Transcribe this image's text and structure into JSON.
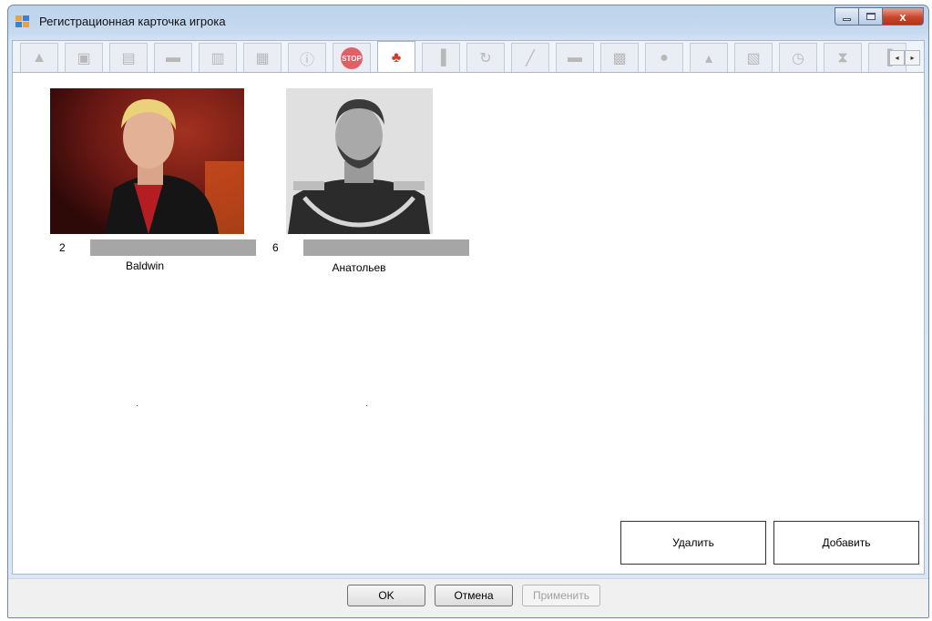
{
  "window": {
    "title": "Регистрационная карточка игрока",
    "close_glyph": "x"
  },
  "tabs": [
    {
      "icon": "user-icon",
      "glyph": "▲",
      "active": false
    },
    {
      "icon": "lock-icon",
      "glyph": "▣",
      "active": false
    },
    {
      "icon": "document-icon",
      "glyph": "▤",
      "active": false
    },
    {
      "icon": "card-icon",
      "glyph": "▬",
      "active": false
    },
    {
      "icon": "page-icon",
      "glyph": "▥",
      "active": false
    },
    {
      "icon": "id-card-icon",
      "glyph": "▦",
      "active": false
    },
    {
      "icon": "info-icon",
      "glyph": "ⓘ",
      "active": false
    },
    {
      "icon": "stop-icon",
      "glyph": "STOP",
      "active": false
    },
    {
      "icon": "people-icon",
      "glyph": "♣",
      "active": true
    },
    {
      "icon": "bar-chart-icon",
      "glyph": "▐",
      "active": false
    },
    {
      "icon": "refresh-icon",
      "glyph": "↻",
      "active": false
    },
    {
      "icon": "pen-icon",
      "glyph": "╱",
      "active": false
    },
    {
      "icon": "car-icon",
      "glyph": "▬",
      "active": false
    },
    {
      "icon": "calculator-icon",
      "glyph": "▩",
      "active": false
    },
    {
      "icon": "coins-icon",
      "glyph": "●",
      "active": false
    },
    {
      "icon": "money-bag-icon",
      "glyph": "▴",
      "active": false
    },
    {
      "icon": "notebook-icon",
      "glyph": "▧",
      "active": false
    },
    {
      "icon": "clock-money-icon",
      "glyph": "◷",
      "active": false
    },
    {
      "icon": "hourglass-icon",
      "glyph": "⧗",
      "active": false
    },
    {
      "icon": "bottle-icon",
      "glyph": "▐",
      "active": false
    }
  ],
  "tab_scroll": {
    "left": "◂",
    "right": "▸"
  },
  "players": [
    {
      "number": "2",
      "name": "Baldwin"
    },
    {
      "number": "6",
      "name": "Анатольев"
    }
  ],
  "actions": {
    "delete_label": "Удалить",
    "add_label": "Добавить"
  },
  "footer": {
    "ok_label": "OK",
    "cancel_label": "Отмена",
    "apply_label": "Применить"
  },
  "colors": {
    "active_tab_accent": "#d03a29",
    "bar_gray": "#a6a6a6",
    "close_button": "#c8472f"
  }
}
